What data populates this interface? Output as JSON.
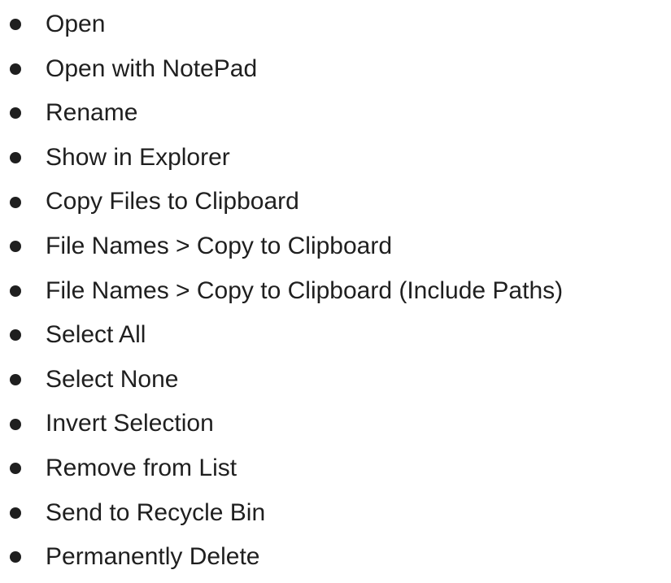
{
  "menu": {
    "items": [
      {
        "label": "Open"
      },
      {
        "label": "Open with NotePad"
      },
      {
        "label": "Rename"
      },
      {
        "label": "Show in Explorer"
      },
      {
        "label": "Copy Files to Clipboard"
      },
      {
        "label": "File Names > Copy to Clipboard"
      },
      {
        "label": "File Names > Copy to Clipboard (Include Paths)"
      },
      {
        "label": "Select All"
      },
      {
        "label": "Select None"
      },
      {
        "label": "Invert Selection"
      },
      {
        "label": "Remove from List"
      },
      {
        "label": "Send to Recycle Bin"
      },
      {
        "label": "Permanently Delete"
      }
    ]
  }
}
